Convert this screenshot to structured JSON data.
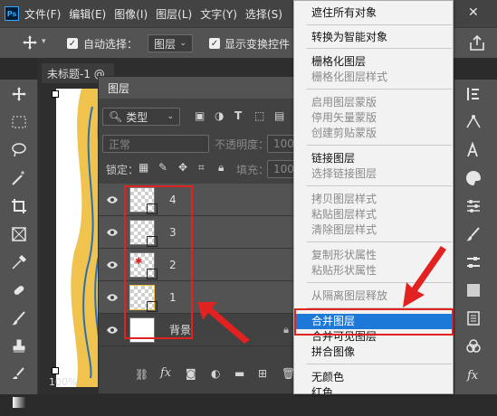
{
  "app": {
    "logo": "Ps"
  },
  "menubar": [
    "文件(F)",
    "编辑(E)",
    "图像(I)",
    "图层(L)",
    "文字(Y)",
    "选择(S)"
  ],
  "options": {
    "auto_select_label": "自动选择：",
    "auto_select_value": "图层",
    "transform_label": "显示变换控件"
  },
  "document": {
    "tab_title": "未标题-1 @",
    "zoom": "100%"
  },
  "layers_panel": {
    "title": "图层",
    "filter_value": "类型",
    "blend_mode": "正常",
    "opacity_label": "不透明度：",
    "opacity_value": "100%",
    "lock_label": "锁定：",
    "fill_label": "填充：",
    "fill_value": "100%",
    "layers": [
      {
        "name": "4"
      },
      {
        "name": "3"
      },
      {
        "name": "2"
      },
      {
        "name": "1"
      },
      {
        "name": "背景"
      }
    ]
  },
  "context_menu": {
    "items": [
      {
        "label": "遮住所有对象",
        "enabled": true
      },
      {
        "label": "转换为智能对象",
        "enabled": true
      },
      {
        "label": "栅格化图层",
        "enabled": true
      },
      {
        "label": "栅格化图层样式",
        "enabled": false
      },
      {
        "label": "启用图层蒙版",
        "enabled": false
      },
      {
        "label": "停用矢量蒙版",
        "enabled": false
      },
      {
        "label": "创建剪贴蒙版",
        "enabled": false
      },
      {
        "label": "链接图层",
        "enabled": true
      },
      {
        "label": "选择链接图层",
        "enabled": false
      },
      {
        "label": "拷贝图层样式",
        "enabled": false
      },
      {
        "label": "粘贴图层样式",
        "enabled": false
      },
      {
        "label": "清除图层样式",
        "enabled": false
      },
      {
        "label": "复制形状属性",
        "enabled": false
      },
      {
        "label": "粘贴形状属性",
        "enabled": false
      },
      {
        "label": "从隔离图层释放",
        "enabled": false
      },
      {
        "label": "合并图层",
        "enabled": true
      },
      {
        "label": "合并可见图层",
        "enabled": true
      },
      {
        "label": "拼合图像",
        "enabled": true
      },
      {
        "label": "无颜色",
        "enabled": true
      },
      {
        "label": "红色",
        "enabled": true
      }
    ],
    "highlighted": "合并图层",
    "highlight_color": "#1c79d8"
  },
  "colors": {
    "annotation": "#e22121",
    "shape_fill": "#f0c24e",
    "shape_stroke": "#2c6fb0"
  }
}
